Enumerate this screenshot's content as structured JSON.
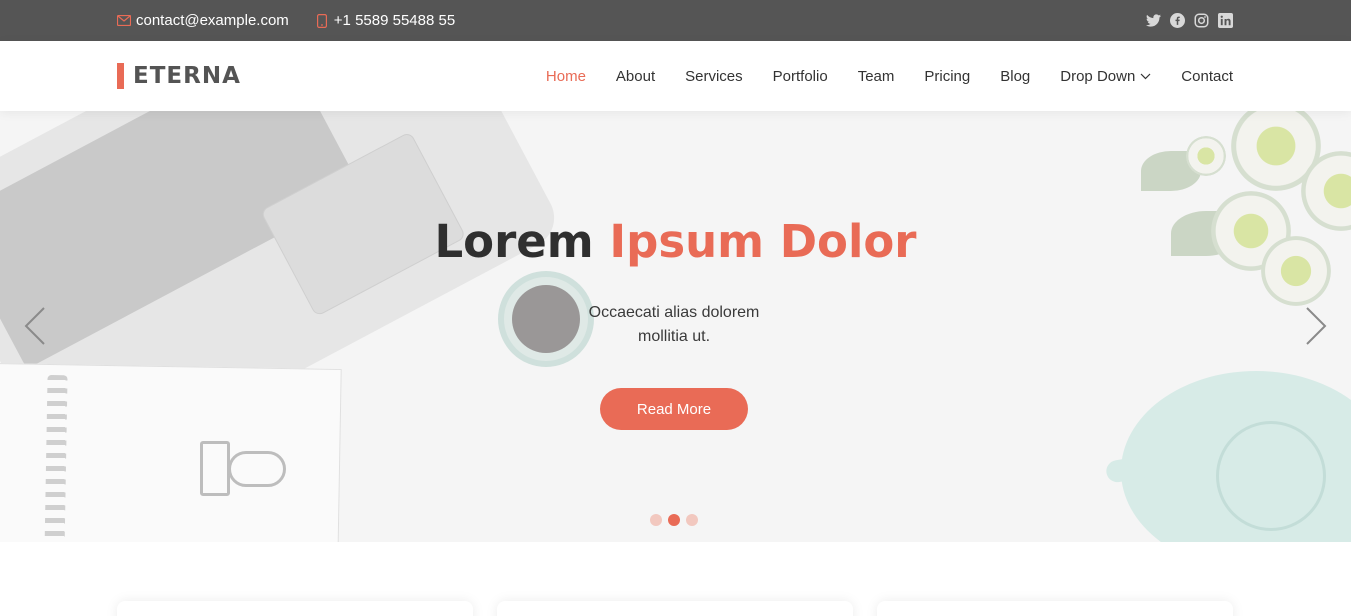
{
  "topbar": {
    "email": "contact@example.com",
    "phone": "+1 5589 55488 55",
    "social": [
      "twitter-icon",
      "facebook-icon",
      "instagram-icon",
      "linkedin-icon"
    ],
    "icon_color": "#e96b56",
    "background": "#555555"
  },
  "header": {
    "logo": "ETERNA",
    "nav": [
      {
        "label": "Home",
        "active": true
      },
      {
        "label": "About"
      },
      {
        "label": "Services"
      },
      {
        "label": "Portfolio"
      },
      {
        "label": "Team"
      },
      {
        "label": "Pricing"
      },
      {
        "label": "Blog"
      },
      {
        "label": "Drop Down",
        "icon": "chevron-down-icon"
      },
      {
        "label": "Contact"
      }
    ]
  },
  "hero": {
    "title_part1": "Lorem",
    "title_part2": "Ipsum Dolor",
    "subtitle": "Occaecati alias dolorem mollitia ut.",
    "button": "Read More",
    "active_slide": 2,
    "slide_count": 3
  },
  "colors": {
    "accent": "#e96b56",
    "text": "#333333"
  }
}
